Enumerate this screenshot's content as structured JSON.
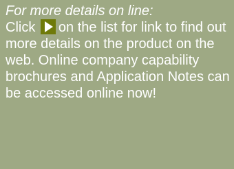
{
  "note": {
    "heading": "For more details on line:",
    "line_before_icon": "Click",
    "icon": "play-icon",
    "text_after_icon": "on the list for link to find out more details on the product on the web. Online company capability brochures and Application Notes can be accessed online now!",
    "colors": {
      "background": "#9ea984",
      "text": "#ffffff",
      "icon_background": "#6f7a0a",
      "icon_glyph": "#ffffff"
    }
  }
}
